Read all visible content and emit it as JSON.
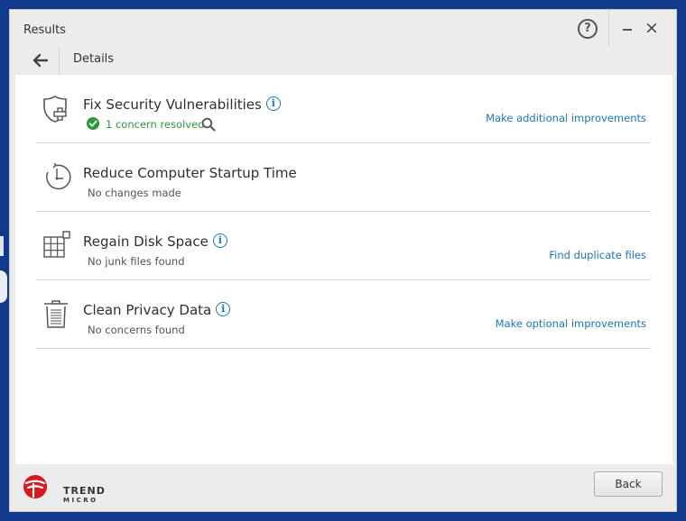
{
  "window": {
    "title": "Results",
    "help_glyph": "?",
    "close_glyph": "×"
  },
  "nav": {
    "title": "Details"
  },
  "rows": [
    {
      "title": "Fix Security Vulnerabilities",
      "status": "1 concern resolved",
      "status_state": "resolved",
      "link": "Make additional improvements",
      "icon": "shield-icon"
    },
    {
      "title": "Reduce Computer Startup Time",
      "status": "No changes made",
      "link": "",
      "icon": "clock-icon"
    },
    {
      "title": "Regain Disk Space",
      "status": "No junk files found",
      "link": "Find duplicate files",
      "icon": "disk-grid-icon"
    },
    {
      "title": "Clean Privacy Data",
      "status": "No concerns found",
      "link": "Make optional improvements",
      "icon": "trash-icon"
    }
  ],
  "info_glyph": "i",
  "footer": {
    "logo_line1": "TREND",
    "logo_line2": "MICRO",
    "back_label": "Back"
  },
  "colors": {
    "accent": "#1a76c2",
    "success": "#2e9a3a",
    "brand_red": "#d71920",
    "desktop": "#123a8c"
  }
}
